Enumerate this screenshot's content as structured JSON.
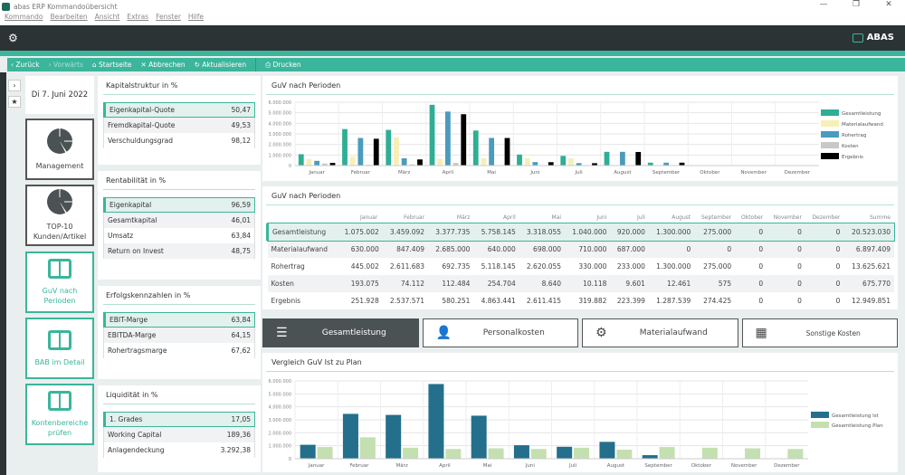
{
  "window": {
    "title": "abas ERP Kommandoübersicht",
    "controls": [
      "—",
      "❐",
      "✕"
    ]
  },
  "menu": [
    "Kommando",
    "Bearbeiten",
    "Ansicht",
    "Extras",
    "Fenster",
    "Hilfe"
  ],
  "brand": "ABAS",
  "toolbar": {
    "back": "‹ Zurück",
    "forward": "› Vorwärts",
    "home": "⌂ Startseite",
    "cancel": "✕ Abbrechen",
    "refresh": "↻ Aktualisieren",
    "print": "⎙ Drucken"
  },
  "date": "Di 7. Juni 2022",
  "tiles": [
    {
      "label": "Management"
    },
    {
      "label": "TOP-10 Kunden/Artikel"
    },
    {
      "label": "GuV nach Perioden"
    },
    {
      "label": "BAB im Detail"
    },
    {
      "label": "Kontenbereiche prüfen"
    }
  ],
  "kpis": [
    {
      "title": "Kapitalstruktur in %",
      "rows": [
        [
          "Eigenkapital-Quote",
          "50,47"
        ],
        [
          "Fremdkapital-Quote",
          "49,53"
        ],
        [
          "Verschuldungsgrad",
          "98,12"
        ]
      ]
    },
    {
      "title": "Rentabilität in %",
      "rows": [
        [
          "Eigenkapital",
          "96,59"
        ],
        [
          "Gesamtkapital",
          "46,01"
        ],
        [
          "Umsatz",
          "63,84"
        ],
        [
          "Return on Invest",
          "48,75"
        ]
      ]
    },
    {
      "title": "Erfolgskennzahlen in %",
      "rows": [
        [
          "EBIT-Marge",
          "63,84"
        ],
        [
          "EBITDA-Marge",
          "64,15"
        ],
        [
          "Rohertragsmarge",
          "67,62"
        ]
      ]
    },
    {
      "title": "Liquidität in %",
      "rows": [
        [
          "1. Grades",
          "17,05"
        ],
        [
          "Working Capital",
          "189,36"
        ],
        [
          "Anlagendeckung",
          "3.292,38"
        ]
      ]
    }
  ],
  "table": {
    "title": "GuV nach Perioden",
    "headers": [
      "",
      "Januar",
      "Februar",
      "März",
      "April",
      "Mai",
      "Juni",
      "Juli",
      "August",
      "September",
      "Oktober",
      "November",
      "Dezember",
      "Summe"
    ],
    "rows": [
      [
        "Gesamtleistung",
        "1.075.002",
        "3.459.092",
        "3.377.735",
        "5.758.145",
        "3.318.055",
        "1.040.000",
        "920.000",
        "1.300.000",
        "275.000",
        "0",
        "0",
        "0",
        "20.523.030"
      ],
      [
        "Materialaufwand",
        "630.000",
        "847.409",
        "2.685.000",
        "640.000",
        "698.000",
        "710.000",
        "687.000",
        "0",
        "0",
        "0",
        "0",
        "0",
        "6.897.409"
      ],
      [
        "Rohertrag",
        "445.002",
        "2.611.683",
        "692.735",
        "5.118.145",
        "2.620.055",
        "330.000",
        "233.000",
        "1.300.000",
        "275.000",
        "0",
        "0",
        "0",
        "13.625.621"
      ],
      [
        "Kosten",
        "193.075",
        "74.112",
        "112.484",
        "254.704",
        "8.640",
        "10.118",
        "9.601",
        "12.461",
        "575",
        "0",
        "0",
        "0",
        "675.770"
      ],
      [
        "Ergebnis",
        "251.928",
        "2.537.571",
        "580.251",
        "4.863.441",
        "2.611.415",
        "319.882",
        "223.399",
        "1.287.539",
        "274.425",
        "0",
        "0",
        "0",
        "12.949.851"
      ]
    ]
  },
  "buttons": [
    {
      "label": "Gesamtleistung",
      "icon": "☰"
    },
    {
      "label": "Personalkosten",
      "icon": "👤"
    },
    {
      "label": "Materialaufwand",
      "icon": "⚙"
    },
    {
      "label": "Sonstige Kosten",
      "icon": "▦"
    }
  ],
  "chart_data": [
    {
      "type": "bar",
      "title": "GuV nach Perioden",
      "categories": [
        "Januar",
        "Februar",
        "März",
        "April",
        "Mai",
        "Juni",
        "Juli",
        "August",
        "September",
        "Oktober",
        "November",
        "Dezember"
      ],
      "ylim": [
        0,
        6000000
      ],
      "yticks": [
        "0",
        "1.000.000",
        "2.000.000",
        "3.000.000",
        "4.000.000",
        "5.000.000",
        "6.000.000"
      ],
      "legend": "right",
      "series": [
        {
          "name": "Gesamtleistung",
          "color": "#2fae94",
          "values": [
            1075002,
            3459092,
            3377735,
            5758145,
            3318055,
            1040000,
            920000,
            1300000,
            275000,
            0,
            0,
            0
          ]
        },
        {
          "name": "Materialaufwand",
          "color": "#f7efb5",
          "values": [
            630000,
            847409,
            2685000,
            640000,
            698000,
            710000,
            687000,
            0,
            0,
            0,
            0,
            0
          ]
        },
        {
          "name": "Rohertrag",
          "color": "#4a9bbd",
          "values": [
            445002,
            2611683,
            692735,
            5118145,
            2620055,
            330000,
            233000,
            1300000,
            275000,
            0,
            0,
            0
          ]
        },
        {
          "name": "Kosten",
          "color": "#c8c8c8",
          "values": [
            193075,
            74112,
            112484,
            254704,
            8640,
            10118,
            9601,
            12461,
            575,
            0,
            0,
            0
          ]
        },
        {
          "name": "Ergebnis",
          "color": "#000000",
          "values": [
            251928,
            2537571,
            580251,
            4863441,
            2611415,
            319882,
            223399,
            1287539,
            274425,
            0,
            0,
            0
          ]
        }
      ]
    },
    {
      "type": "bar",
      "title": "Vergleich GuV Ist zu Plan",
      "categories": [
        "Januar",
        "Februar",
        "März",
        "April",
        "Mai",
        "Juni",
        "Juli",
        "August",
        "September",
        "Oktober",
        "November",
        "Dezember"
      ],
      "ylim": [
        0,
        6000000
      ],
      "yticks": [
        "0",
        "1.000.000",
        "2.000.000",
        "3.000.000",
        "4.000.000",
        "5.000.000",
        "6.000.000"
      ],
      "legend": "right",
      "series": [
        {
          "name": "Gesamtleistung Ist",
          "color": "#236f8c",
          "values": [
            1075002,
            3459092,
            3377735,
            5758145,
            3318055,
            1040000,
            920000,
            1300000,
            275000,
            0,
            0,
            0
          ]
        },
        {
          "name": "Gesamtleistung Plan",
          "color": "#c4e0b0",
          "values": [
            900000,
            1650000,
            850000,
            750000,
            800000,
            750000,
            850000,
            700000,
            900000,
            850000,
            800000,
            750000
          ]
        }
      ]
    }
  ]
}
